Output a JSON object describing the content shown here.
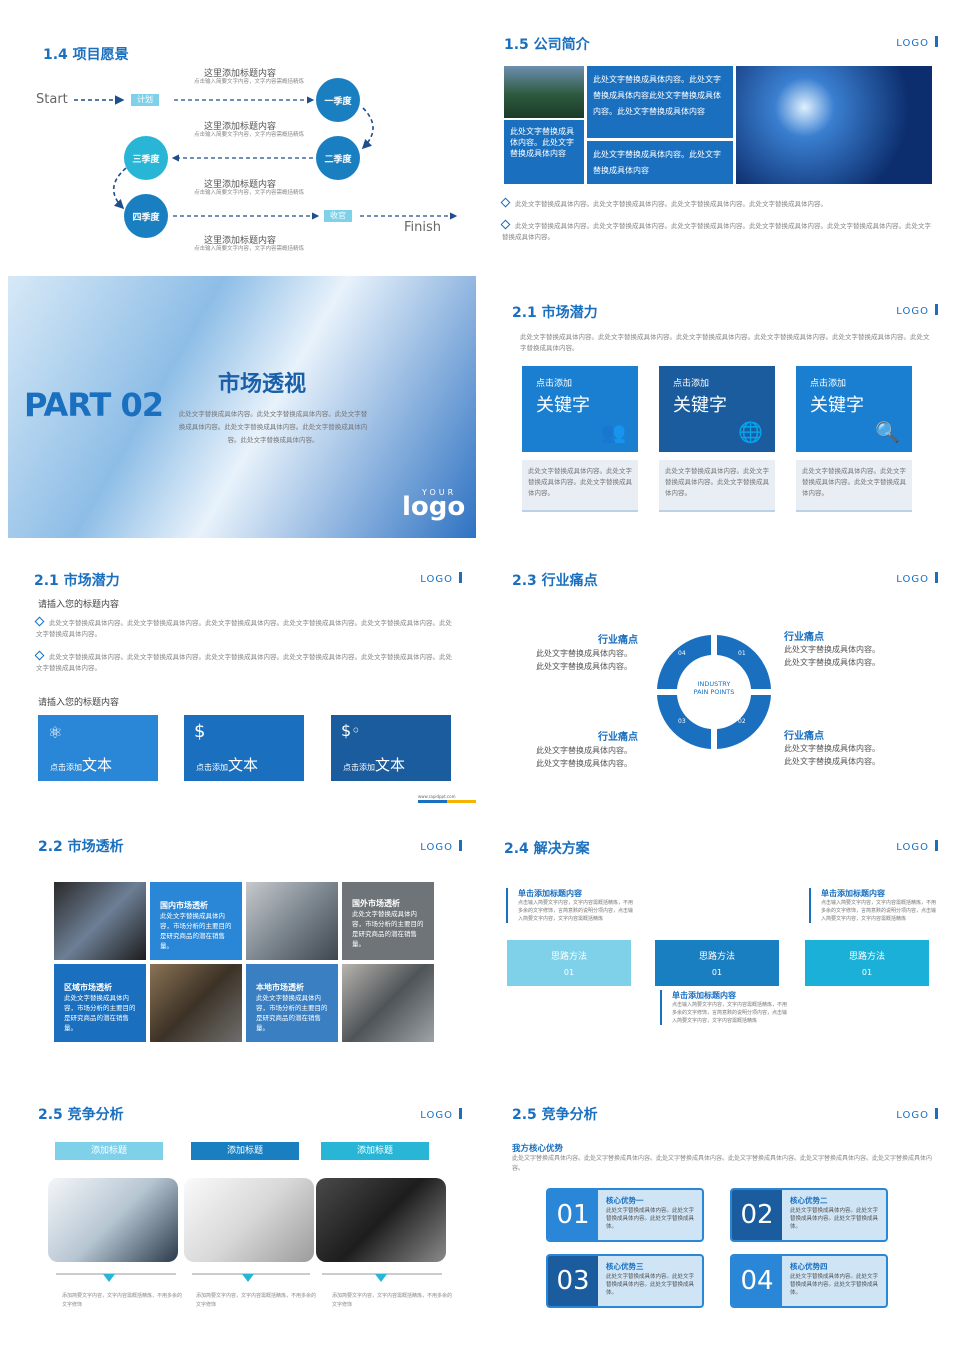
{
  "s1": {
    "title": "1.4 项目愿景",
    "start": "Start",
    "finish": "Finish",
    "plan": "计划",
    "harvest": "收官",
    "q1": "一季度",
    "q2": "二季度",
    "q3": "三季度",
    "q4": "四季度",
    "heading": "这里添加标题内容",
    "sub": "点击输入简要文字内容，文字内容需概括精炼"
  },
  "s2": {
    "title": "1.5 公司简介",
    "logo": "LOGO",
    "box1": "此处文字替换成具体内容。此处文字替换成具体内容此处文字替换成具体内容。此处文字替换成具体内容",
    "box2": "此处文字替换成具体内容。此处文字替换成具体内容",
    "box3": "此处文字替换成具体内容。此处文字替换成具体内容",
    "line1": "此处文字替换成具体内容。此处文字替换成具体内容。此处文字替换成具体内容。此处文字替换成具体内容。",
    "line2": "此处文字替换成具体内容。此处文字替换成具体内容。此处文字替换成具体内容。此处文字替换成具体内容。此处文字替换成具体内容。此处文字替换成具体内容。"
  },
  "s3": {
    "part": "PART 02",
    "title": "市场透视",
    "body": "此处文字替换成具体内容。此处文字替换成具体内容。此处文字替换成具体内容。此处文字替换成具体内容。此处文字替换成具体内容。此处文字替换成具体内容。",
    "your": "YOUR",
    "logo": "logo"
  },
  "s4": {
    "title": "2.1 市场潜力",
    "logo": "LOGO",
    "intro": "此处文字替换成具体内容。此处文字替换成具体内容。此处文字替换成具体内容。此处文字替换成具体内容。此处文字替换成具体内容。此处文字替换成具体内容。",
    "cards": [
      {
        "small": "点击添加",
        "big": "关键字",
        "text": "此处文字替换成具体内容。此处文字替换成具体内容。此处文字替换成具体内容。"
      },
      {
        "small": "点击添加",
        "big": "关键字",
        "text": "此处文字替换成具体内容。此处文字替换成具体内容。此处文字替换成具体内容。"
      },
      {
        "small": "点击添加",
        "big": "关键字",
        "text": "此处文字替换成具体内容。此处文字替换成具体内容。此处文字替换成具体内容。"
      }
    ]
  },
  "s5": {
    "title": "2.1 市场潜力",
    "logo": "LOGO",
    "heading1": "请插入您的标题内容",
    "p1": "此处文字替换成具体内容。此处文字替换成具体内容。此处文字替换成具体内容。此处文字替换成具体内容。此处文字替换成具体内容。此处文字替换成具体内容。",
    "p2": "此处文字替换成具体内容。此处文字替换成具体内容。此处文字替换成具体内容。此处文字替换成具体内容。此处文字替换成具体内容。此处文字替换成具体内容。",
    "heading2": "请插入您的标题内容",
    "btn_small": "点击添加",
    "btn_big": "文本",
    "url": "www.rapidppt.com"
  },
  "s6": {
    "title": "2.3 行业痛点",
    "logo": "LOGO",
    "center1": "INDUSTRY",
    "center2": "PAIN POINTS",
    "label": "行业痛点",
    "text1": "此处文字替换成具体内容。",
    "text2": "此处文字替换成具体内容。",
    "n1": "01",
    "n2": "02",
    "n3": "03",
    "n4": "04"
  },
  "s7": {
    "title": "2.2 市场透析",
    "logo": "LOGO",
    "t1": "国内市场透析",
    "b1": "此处文字替换成具体内容，市场分析的主要目的是研究商品的潜在销售量。",
    "t2": "国外市场透析",
    "b2": "此处文字替换成具体内容，市场分析的主要目的是研究商品的潜在销售量。",
    "t3": "区域市场透析",
    "b3": "此处文字替换成具体内容，市场分析的主要目的是研究商品的潜在销售量。",
    "t4": "本地市场透析",
    "b4": "此处文字替换成具体内容，市场分析的主要目的是研究商品的潜在销售量。"
  },
  "s8": {
    "title": "2.4 解决方案",
    "logo": "LOGO",
    "head": "单击添加标题内容",
    "body": "点击输入简要文字内容，文字内容需概括精炼，不用多余的文字修饰，言简意赅的说明分项内容，点击输入简要文字内容，文字内容需概括精炼",
    "method": "思路方法",
    "num": "01"
  },
  "s9": {
    "title": "2.5 竞争分析",
    "logo": "LOGO",
    "tab": "添加标题",
    "caption": "添加简要文字内容，文字内容需概括精炼，不用多余的文字修饰"
  },
  "s10": {
    "title": "2.5 竞争分析",
    "logo": "LOGO",
    "head": "我方核心优势",
    "intro": "此处文字替换成具体内容。此处文字替换成具体内容。此处文字替换成具体内容。此处文字替换成具体内容。此处文字替换成具体内容。此处文字替换成具体内容。",
    "items": [
      {
        "n": "01",
        "t": "核心优势一",
        "b": "此处文字替换成具体内容。此处文字替换成具体内容。此处文字替换成具体。"
      },
      {
        "n": "02",
        "t": "核心优势二",
        "b": "此处文字替换成具体内容。此处文字替换成具体内容。此处文字替换成具体。"
      },
      {
        "n": "03",
        "t": "核心优势三",
        "b": "此处文字替换成具体内容。此处文字替换成具体内容。此处文字替换成具体。"
      },
      {
        "n": "04",
        "t": "核心优势四",
        "b": "此处文字替换成具体内容。此处文字替换成具体内容。此处文字替换成具体。"
      }
    ]
  }
}
